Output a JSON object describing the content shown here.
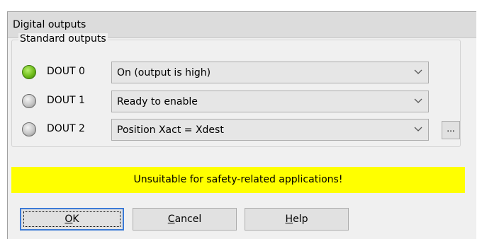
{
  "dialog": {
    "title": "Digital outputs"
  },
  "group": {
    "title": "Standard outputs"
  },
  "outputs": [
    {
      "label": "DOUT 0",
      "state": "on",
      "value": "On (output is high)"
    },
    {
      "label": "DOUT 1",
      "state": "off",
      "value": "Ready to enable"
    },
    {
      "label": "DOUT 2",
      "state": "off",
      "value": "Position Xact = Xdest"
    }
  ],
  "more_button": {
    "label": "..."
  },
  "warning": {
    "text": "Unsuitable for safety-related applications!",
    "color": "#ffff00"
  },
  "buttons": {
    "ok": {
      "mnemonic": "O",
      "rest": "K"
    },
    "cancel": {
      "mnemonic": "C",
      "rest": "ancel"
    },
    "help": {
      "mnemonic": "H",
      "rest": "elp"
    }
  },
  "colors": {
    "led_on": "#6fbc1a",
    "led_off": "#c6c6c6",
    "focus_border": "#3b7ad6"
  },
  "icons": [
    "led-on-icon",
    "led-off-icon",
    "chevron-down-icon"
  ]
}
